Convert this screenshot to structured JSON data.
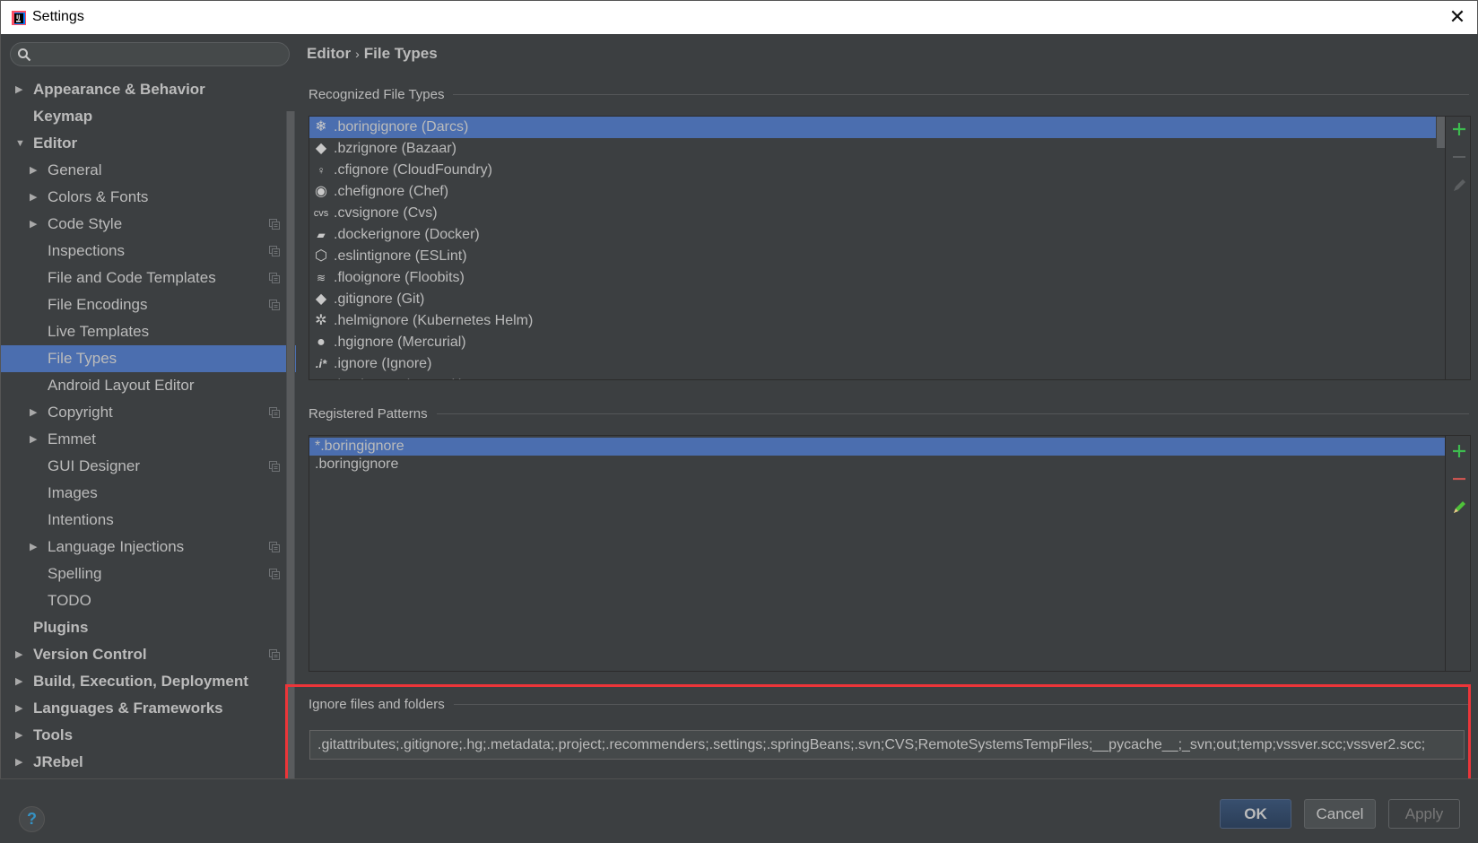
{
  "window": {
    "title": "Settings",
    "app_icon": "intellij-idea-icon",
    "close_icon": "close-icon"
  },
  "search": {
    "placeholder": "",
    "value": "",
    "icon": "search-icon"
  },
  "sidebar": {
    "items": [
      {
        "label": "Appearance & Behavior",
        "level": 0,
        "bold": true,
        "expandable": true,
        "expanded": false,
        "project_scope": false,
        "selected": false
      },
      {
        "label": "Keymap",
        "level": 0,
        "bold": true,
        "expandable": false,
        "expanded": false,
        "project_scope": false,
        "selected": false
      },
      {
        "label": "Editor",
        "level": 0,
        "bold": true,
        "expandable": true,
        "expanded": true,
        "project_scope": false,
        "selected": false
      },
      {
        "label": "General",
        "level": 1,
        "bold": false,
        "expandable": true,
        "expanded": false,
        "project_scope": false,
        "selected": false
      },
      {
        "label": "Colors & Fonts",
        "level": 1,
        "bold": false,
        "expandable": true,
        "expanded": false,
        "project_scope": false,
        "selected": false
      },
      {
        "label": "Code Style",
        "level": 1,
        "bold": false,
        "expandable": true,
        "expanded": false,
        "project_scope": true,
        "selected": false
      },
      {
        "label": "Inspections",
        "level": 1,
        "bold": false,
        "expandable": false,
        "expanded": false,
        "project_scope": true,
        "selected": false
      },
      {
        "label": "File and Code Templates",
        "level": 1,
        "bold": false,
        "expandable": false,
        "expanded": false,
        "project_scope": true,
        "selected": false
      },
      {
        "label": "File Encodings",
        "level": 1,
        "bold": false,
        "expandable": false,
        "expanded": false,
        "project_scope": true,
        "selected": false
      },
      {
        "label": "Live Templates",
        "level": 1,
        "bold": false,
        "expandable": false,
        "expanded": false,
        "project_scope": false,
        "selected": false
      },
      {
        "label": "File Types",
        "level": 1,
        "bold": false,
        "expandable": false,
        "expanded": false,
        "project_scope": false,
        "selected": true
      },
      {
        "label": "Android Layout Editor",
        "level": 1,
        "bold": false,
        "expandable": false,
        "expanded": false,
        "project_scope": false,
        "selected": false
      },
      {
        "label": "Copyright",
        "level": 1,
        "bold": false,
        "expandable": true,
        "expanded": false,
        "project_scope": true,
        "selected": false
      },
      {
        "label": "Emmet",
        "level": 1,
        "bold": false,
        "expandable": true,
        "expanded": false,
        "project_scope": false,
        "selected": false
      },
      {
        "label": "GUI Designer",
        "level": 1,
        "bold": false,
        "expandable": false,
        "expanded": false,
        "project_scope": true,
        "selected": false
      },
      {
        "label": "Images",
        "level": 1,
        "bold": false,
        "expandable": false,
        "expanded": false,
        "project_scope": false,
        "selected": false
      },
      {
        "label": "Intentions",
        "level": 1,
        "bold": false,
        "expandable": false,
        "expanded": false,
        "project_scope": false,
        "selected": false
      },
      {
        "label": "Language Injections",
        "level": 1,
        "bold": false,
        "expandable": true,
        "expanded": false,
        "project_scope": true,
        "selected": false
      },
      {
        "label": "Spelling",
        "level": 1,
        "bold": false,
        "expandable": false,
        "expanded": false,
        "project_scope": true,
        "selected": false
      },
      {
        "label": "TODO",
        "level": 1,
        "bold": false,
        "expandable": false,
        "expanded": false,
        "project_scope": false,
        "selected": false
      },
      {
        "label": "Plugins",
        "level": 0,
        "bold": true,
        "expandable": false,
        "expanded": false,
        "project_scope": false,
        "selected": false
      },
      {
        "label": "Version Control",
        "level": 0,
        "bold": true,
        "expandable": true,
        "expanded": false,
        "project_scope": true,
        "selected": false
      },
      {
        "label": "Build, Execution, Deployment",
        "level": 0,
        "bold": true,
        "expandable": true,
        "expanded": false,
        "project_scope": false,
        "selected": false
      },
      {
        "label": "Languages & Frameworks",
        "level": 0,
        "bold": true,
        "expandable": true,
        "expanded": false,
        "project_scope": false,
        "selected": false
      },
      {
        "label": "Tools",
        "level": 0,
        "bold": true,
        "expandable": true,
        "expanded": false,
        "project_scope": false,
        "selected": false
      },
      {
        "label": "JRebel",
        "level": 0,
        "bold": true,
        "expandable": true,
        "expanded": false,
        "project_scope": false,
        "selected": false
      }
    ]
  },
  "breadcrumb": {
    "parent": "Editor",
    "separator": "›",
    "current": "File Types"
  },
  "recognized": {
    "title": "Recognized File Types",
    "items": [
      {
        "label": ".boringignore (Darcs)",
        "icon": "darcs-icon",
        "glyph": "❄",
        "selected": true
      },
      {
        "label": ".bzrignore (Bazaar)",
        "icon": "bazaar-icon",
        "glyph": "◆",
        "selected": false
      },
      {
        "label": ".cfignore (CloudFoundry)",
        "icon": "cloudfoundry-icon",
        "glyph": "♀",
        "selected": false
      },
      {
        "label": ".chefignore (Chef)",
        "icon": "chef-icon",
        "glyph": "◉",
        "selected": false
      },
      {
        "label": ".cvsignore (Cvs)",
        "icon": "cvs-icon",
        "glyph": "cvs",
        "selected": false
      },
      {
        "label": ".dockerignore (Docker)",
        "icon": "docker-icon",
        "glyph": "▰",
        "selected": false
      },
      {
        "label": ".eslintignore (ESLint)",
        "icon": "eslint-icon",
        "glyph": "⬡",
        "selected": false
      },
      {
        "label": ".flooignore (Floobits)",
        "icon": "floobits-icon",
        "glyph": "≋",
        "selected": false
      },
      {
        "label": ".gitignore (Git)",
        "icon": "git-icon",
        "glyph": "◆",
        "selected": false
      },
      {
        "label": ".helmignore (Kubernetes Helm)",
        "icon": "helm-icon",
        "glyph": "✲",
        "selected": false
      },
      {
        "label": ".hgignore (Mercurial)",
        "icon": "mercurial-icon",
        "glyph": "●",
        "selected": false
      },
      {
        "label": ".ignore (Ignore)",
        "icon": "ignore-icon",
        "glyph": ".i*",
        "selected": false
      },
      {
        "label": ".jpmignore (Jetpack)",
        "icon": "jetpack-icon",
        "glyph": "**",
        "selected": false
      }
    ],
    "toolbar": {
      "add": "add-icon",
      "remove": "remove-icon",
      "edit": "edit-icon"
    }
  },
  "patterns": {
    "title": "Registered Patterns",
    "items": [
      {
        "label": "*.boringignore",
        "selected": true
      },
      {
        "label": ".boringignore",
        "selected": false
      }
    ],
    "toolbar": {
      "add": "add-icon",
      "remove": "remove-icon",
      "edit": "edit-icon"
    }
  },
  "ignore": {
    "title": "Ignore files and folders",
    "value": ".gitattributes;.gitignore;.hg;.metadata;.project;.recommenders;.settings;.springBeans;.svn;CVS;RemoteSystemsTempFiles;__pycache__;_svn;out;temp;vssver.scc;vssver2.scc;"
  },
  "buttons": {
    "ok": "OK",
    "cancel": "Cancel",
    "apply": "Apply",
    "help": "?"
  },
  "colors": {
    "accent": "#4b6eaf",
    "background": "#3c3f41",
    "highlight_box": "#ec3539",
    "add": "#3dbb4f",
    "remove": "#c75450"
  }
}
